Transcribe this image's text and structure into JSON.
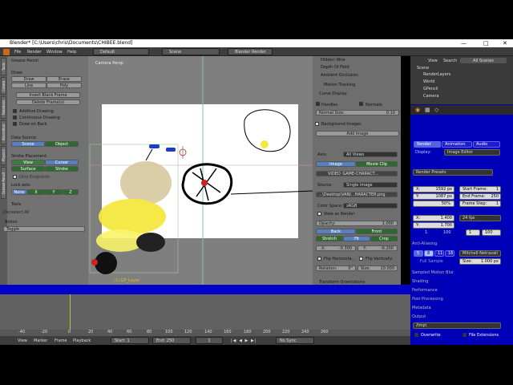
{
  "window": {
    "title": "Blender* [C:\\Users\\chris\\Documents\\CHIBEE.blend]"
  },
  "menubar": {
    "file": "File",
    "render": "Render",
    "window": "Window",
    "help": "Help",
    "screen": "Default",
    "scene": "Scene",
    "engine": "Blender Render"
  },
  "toolshelf": {
    "tabs": [
      "Tools",
      "Create",
      "Relations",
      "Animation",
      "Physics",
      "Grease Pencil"
    ],
    "panel_title": "Grease Pencil",
    "draw_label": "Draw:",
    "draw": "Draw",
    "erase": "Erase",
    "line": "Line",
    "poly": "Poly",
    "insert_blank": "Insert Blank Frame",
    "delete_frames": "Delete Frame(s)",
    "additive": "Additive Drawing",
    "continuous": "Continuous Drawing",
    "draw_on_back": "Draw on Back",
    "data_source": "Data Source:",
    "scene": "Scene",
    "object": "Object",
    "stroke_placement": "Stroke Placement:",
    "view": "View",
    "cursor": "Cursor",
    "surface": "Surface",
    "stroke": "Stroke",
    "only_endpoints": "Only Endpoints",
    "lock_axis": "Lock axis:",
    "none": "None",
    "x": "X",
    "y": "Y",
    "z": "Z",
    "tools": "Tools",
    "op_title": "(De)select All",
    "action_label": "Action",
    "action": "Toggle"
  },
  "viewport": {
    "label": "Camera Persp",
    "layer": "(1) GP_Layer"
  },
  "properties": {
    "hidden_wire": "Hidden Wire",
    "dof": "Depth Of Field",
    "ao": "Ambient Occlusion",
    "motion_tracking": "Motion Tracking",
    "curve_display": "Curve Display",
    "handles": "Handles",
    "normals": "Normals",
    "normal_size": "Normal Size:",
    "normal_size_val": "0.10",
    "bg_images": "Background Images",
    "add_image": "Add Image",
    "axis": "Axis:",
    "all_views": "All Views",
    "image": "Image",
    "movie_clip": "Movie Clip",
    "file1": "VIDEO_GAME-CHARACT...",
    "file2": "VIDEO_GAME-CHARACTER.png",
    "source": "Source:",
    "single_image": "Single Image",
    "path": "..\\Desktop\\VANI...HARACTER.png",
    "color_space": "Color Space:",
    "srgb": "sRGB",
    "view_render": "View as Render",
    "opacity": "Opacity:",
    "opacity_val": "1.000",
    "back": "Back",
    "front": "Front",
    "stretch": "Stretch",
    "fit": "Fit",
    "crop": "Crop",
    "x": "X:",
    "x_val": "-0.300",
    "y": "Y:",
    "y_val": "-0.200",
    "flip_h": "Flip Horizonta...",
    "flip_v": "Flip Vertically",
    "rotation": "Rotation:",
    "rotation_val": "0°",
    "size": "Size:",
    "size_val": "10.000",
    "transform_orient": "Transform Orientations"
  },
  "outliner": {
    "view": "View",
    "search": "Search",
    "all_scenes": "All Scenes",
    "items": [
      "Scene",
      "RenderLayers",
      "World",
      "GPencil",
      "Camera"
    ]
  },
  "render": {
    "tabs": [
      "Render",
      "Animation",
      "Audio"
    ],
    "display": "Image Editor",
    "presets": "Render Presets",
    "resx": "X:",
    "resx_val": "1592 px",
    "resy": "Y:",
    "resy_val": "1087 px",
    "pct": "50%",
    "start": "Start Frame:",
    "start_val": "1",
    "end": "End Frame:",
    "end_val": "250",
    "step": "Frame Step:",
    "step_val": "1",
    "aspx": "X:",
    "aspx_val": "1.400",
    "aspy": "Y:",
    "aspy_val": "1.700",
    "fps": "24 fps",
    "fr1": "1",
    "fr2": "100",
    "fr3": "1",
    "fr4": "100",
    "aa": "Anti-Aliasing",
    "aa_vals": [
      "5",
      "8",
      "11",
      "16"
    ],
    "filter": "Mitchell-Netravali",
    "full_sample": "Full Sample",
    "size": "Size:",
    "size_val": "1.000 px",
    "sections": [
      "Sampled Motion Blur",
      "Shading",
      "Performance",
      "Post Processing",
      "Metadata",
      "Output"
    ],
    "output_path": "/tmp\\",
    "overwrite": "Overwrite",
    "file_ext": "File Extensions"
  },
  "timeline": {
    "ticks": [
      "-40",
      "-20",
      "0",
      "20",
      "40",
      "60",
      "80",
      "100",
      "120",
      "140",
      "160",
      "180",
      "200",
      "220",
      "240",
      "260"
    ],
    "view": "View",
    "marker": "Marker",
    "frame": "Frame",
    "playback": "Playback",
    "start": "Start:",
    "start_val": "1",
    "end": "End:",
    "end_val": "250",
    "current": "1",
    "sync": "No Sync"
  }
}
